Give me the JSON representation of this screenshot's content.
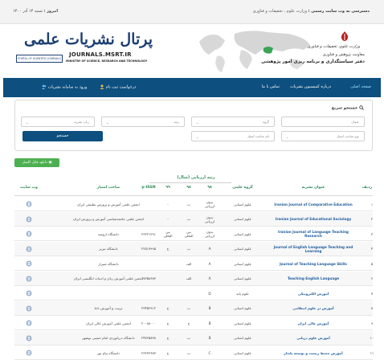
{
  "topbar": {
    "date_label": "امروز :",
    "date_value": "شنبه ۱۴ آذر ۱۴۰۰",
    "access_label": "دسترسی به وب سایت رسمی :",
    "access_value": "وزارت علوم ، تحقیقات و فناوری"
  },
  "header": {
    "portal_title": "پرتال نشریات علمی",
    "portal_en": "PORTAL OF SCIENTIFIC JOURNALS",
    "domain": "JOURNALS.MSRT.IR",
    "ministry_en": "MINISTRY OF SCIENCE, RESEARCH AND TECHNOLOGY",
    "calligraphy": "وزارت علوم، تحقیقات و فناوری",
    "ministry_fa": "معاونت پژوهش و فناوری",
    "office_fa": "دفتر سیاستگذاری و برنامه ریزی امور پژوهشی"
  },
  "nav": {
    "home": "صفحه اصلی",
    "about": "درباره کمیسیون نشریات",
    "contact": "تماس با ما",
    "register": "درخواست ثبت نام",
    "login": "ورود به سامانه نشریات"
  },
  "search": {
    "title": "جستجو سریع",
    "fields": {
      "subject": "عنوان",
      "group": "گروه",
      "rank": "رتبه",
      "language": "زبان نشریه",
      "type": "نوع صاحب امتیاز",
      "owner": "نام صاحب امتیاز"
    },
    "button": "جستجو"
  },
  "download_label": "دانلود فایل اکسل",
  "table": {
    "group_header": "رتبه ارزیابی (سال)",
    "headers": {
      "row": "ردیف",
      "title": "عنوان نشریه",
      "group": "گروه علمی",
      "y98": "۹۸",
      "y99a": "۹۸",
      "y99": "۹۹",
      "pissn": "p-ISSN",
      "owner": "صاحب امتیاز",
      "site": "وب سایت"
    },
    "rows": [
      {
        "n": "۱",
        "title": "Iranian Journal of Comparative Education",
        "group": "علوم انسانی",
        "r1": "بدون ارزیابی",
        "r2": "ب",
        "r3": "-",
        "issn": "",
        "owner": "انجمن علمی آموزش و پرورش تطبیقی ایران"
      },
      {
        "n": "۲",
        "title": "Iranian Journal of Educational Sociology",
        "group": "علوم انسانی",
        "r1": "بدون ارزیابی",
        "r2": "ب",
        "r3": "-",
        "issn": "",
        "owner": "انجمن علمی جامعه‌شناسی آموزش و پرورش ایران"
      },
      {
        "n": "۳",
        "title": "Iranian Journal of Language Teaching Research",
        "group": "علوم انسانی",
        "r1": "بدون ارزیابی",
        "r2": "بین المللی",
        "r3": "بین المللی",
        "issn": "۲۳۲۲۱۲۹۱",
        "owner": "دانشگاه ارومیه"
      },
      {
        "n": "۴",
        "title": "Journal of English Language Teaching and Learning",
        "group": "علوم انسانی",
        "r1": "A",
        "r2": "ب",
        "r3": "ج",
        "issn": "۲۲۵۱۷۹۹۵",
        "owner": "دانشگاه تبریز"
      },
      {
        "n": "۵",
        "title": "Journal of Teaching Language Skills",
        "group": "علوم انسانی",
        "r1": "A",
        "r2": "الف",
        "r3": "",
        "issn": "",
        "owner": "دانشگاه شیراز"
      },
      {
        "n": "۶",
        "title": "Teaching English Language",
        "group": "علوم انسانی",
        "r1": "A",
        "r2": "الف",
        "r3": "",
        "issn": "۱۷۳۵۸۶۸۳",
        "owner": "انجمن علمی آموزش زبان و ادبیات انگلیسی ایران"
      },
      {
        "n": "۷",
        "title": "آموزش الکترونیکی",
        "group": "علوم پایه",
        "r1": "D",
        "r2": "",
        "r3": "",
        "issn": "",
        "owner": ""
      },
      {
        "n": "۸",
        "title": "آموزش در علوم انتظامی",
        "group": "علوم انسانی",
        "r1": "B",
        "r2": "ب",
        "r3": "ج",
        "issn": "۲۳۴۵۶۹۱۲",
        "owner": "تربیت و آموزش ناجا"
      },
      {
        "n": "۹",
        "title": "آموزش عالی ایران",
        "group": "علوم انسانی",
        "r1": "B",
        "r2": "ج",
        "r3": "ج",
        "issn": "۲۰۰۸۸۰۰۰",
        "owner": "انجمن علمی آموزش عالی ایران"
      },
      {
        "n": "۱۰",
        "title": "آموزش علوم دریایی",
        "group": "علوم انسانی",
        "r1": "B",
        "r2": "ب",
        "r3": "ج",
        "issn": "۲۴۷۶۵۸۳۸",
        "owner": "دانشگاه دریانوردی امام خمینی نوشهر"
      },
      {
        "n": "۱۱",
        "title": "آموزش محیط زیست و توسعه پایدار",
        "group": "علوم انسانی",
        "r1": "C",
        "r2": "ب",
        "r3": "ج",
        "issn": "۲۳۲۲۳۶۸۳",
        "owner": "دانشگاه پیام نور"
      }
    ]
  },
  "colors": {
    "nav_bg": "#0d4f7f",
    "accent_green": "#2e8b57",
    "download_green": "#4caf50",
    "title_blue": "#1d5c9c"
  }
}
